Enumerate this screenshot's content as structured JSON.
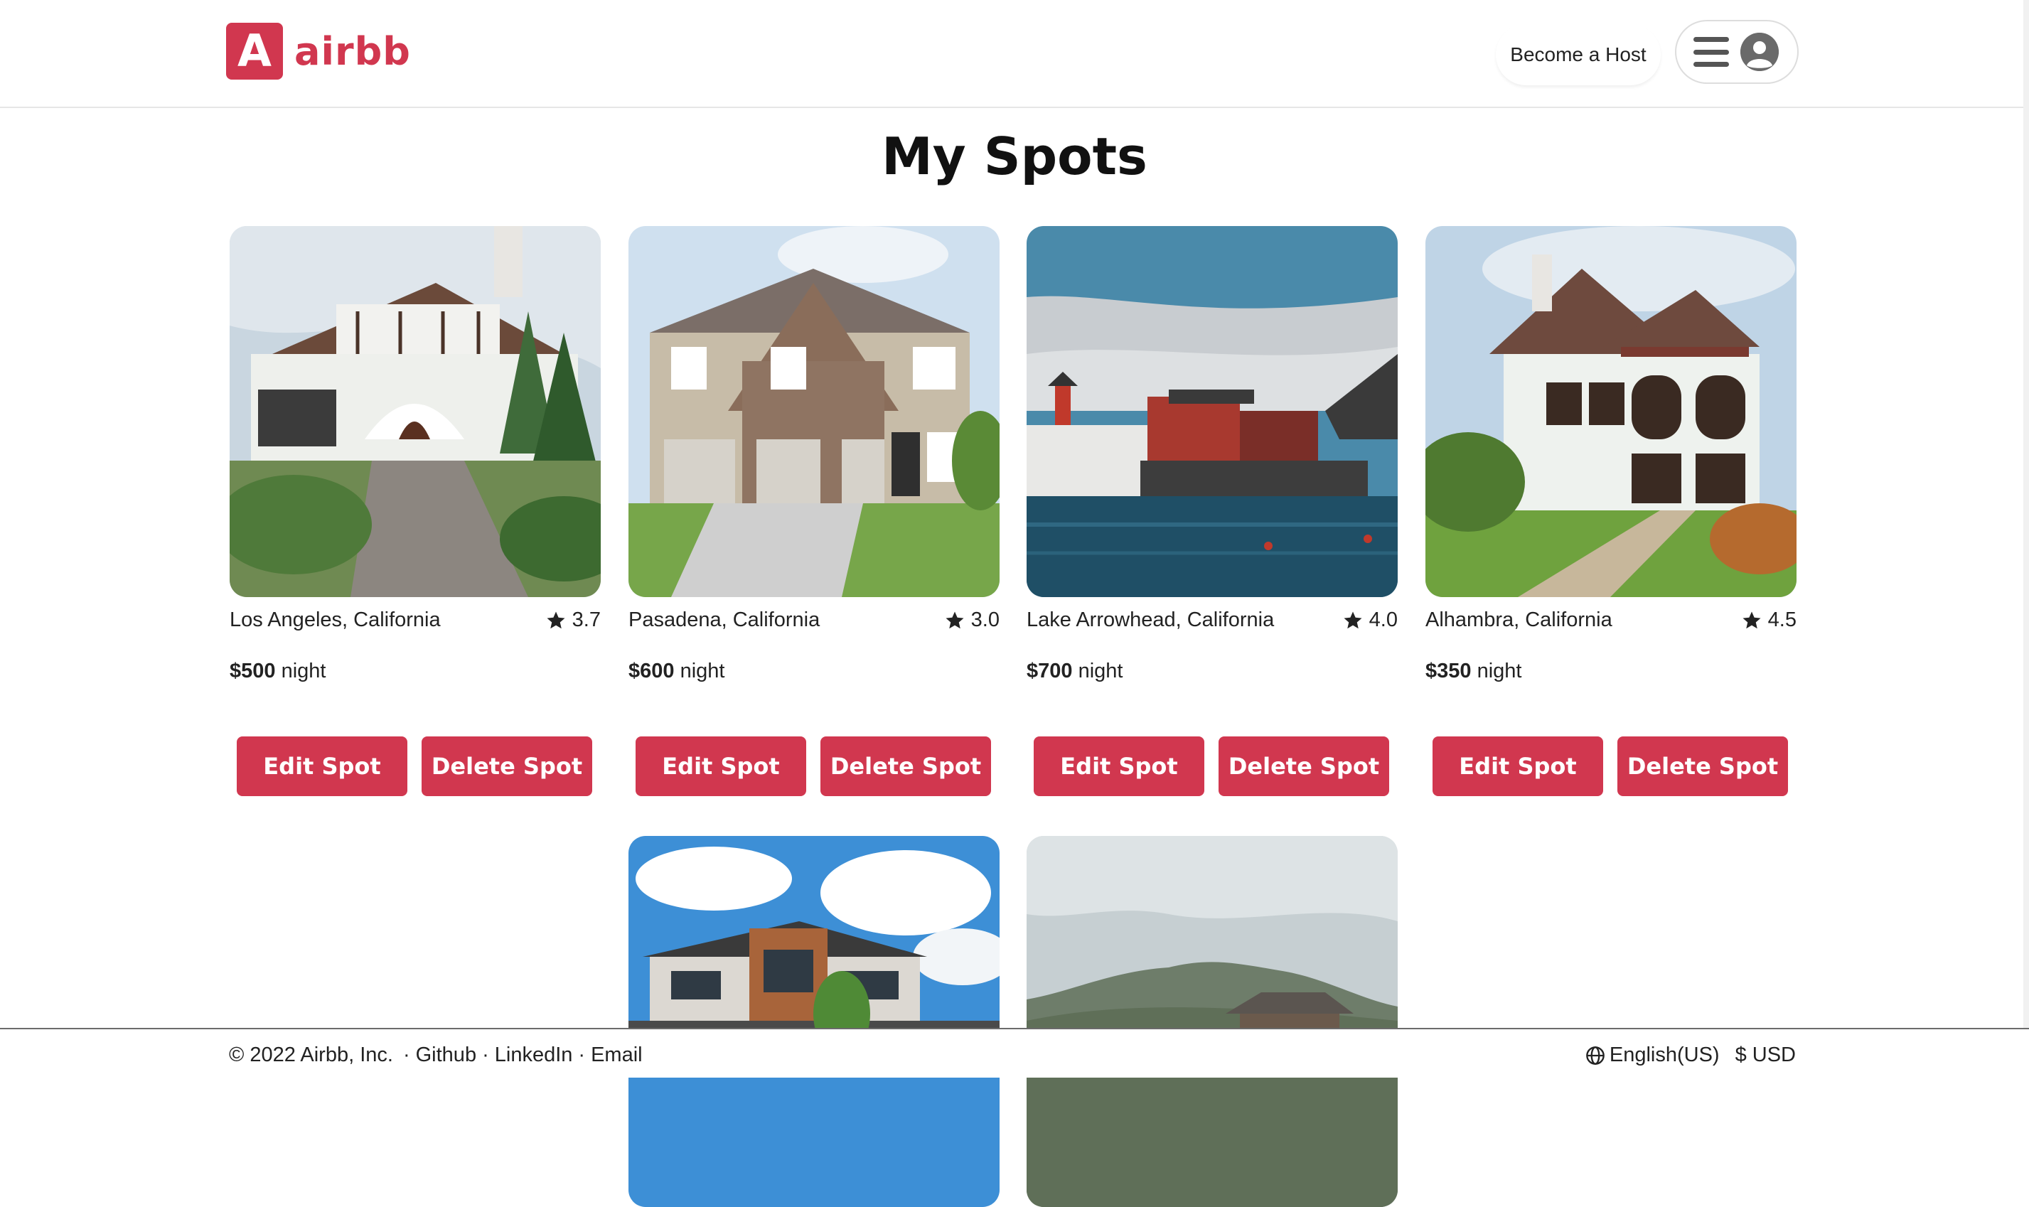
{
  "header": {
    "logo_letter": "A",
    "logo_text": "airbb",
    "become_host": "Become a Host",
    "brand_color": "#d1374f"
  },
  "page": {
    "title": "My Spots"
  },
  "spots": [
    {
      "location": "Los Angeles, California",
      "rating": "3.7",
      "price": "$500",
      "price_unit": "night",
      "edit_label": "Edit Spot",
      "delete_label": "Delete Spot",
      "image": "tudor-style white house with stone path"
    },
    {
      "location": "Pasadena, California",
      "rating": "3.0",
      "price": "$600",
      "price_unit": "night",
      "edit_label": "Edit Spot",
      "delete_label": "Delete Spot",
      "image": "two-story beige house with two-car garage"
    },
    {
      "location": "Lake Arrowhead, California",
      "rating": "4.0",
      "price": "$700",
      "price_unit": "night",
      "edit_label": "Edit Spot",
      "delete_label": "Delete Spot",
      "image": "red waterfront cabins on rocky shore"
    },
    {
      "location": "Alhambra, California",
      "rating": "4.5",
      "price": "$350",
      "price_unit": "night",
      "edit_label": "Edit Spot",
      "delete_label": "Delete Spot",
      "image": "white chalet house with balconies"
    },
    {
      "image": "modern house with wood and stone facade"
    },
    {
      "image": "wooden cabin below mountain"
    }
  ],
  "footer": {
    "copyright": "© 2022 Airbb, Inc.",
    "link_github": "Github",
    "link_linkedin": "LinkedIn",
    "link_email": "Email",
    "separator": "·",
    "language": "English(US)",
    "currency": "$ USD"
  },
  "icons": {
    "logo": "letter-a-logo-icon",
    "menu": "hamburger-menu-icon",
    "user": "user-avatar-icon",
    "rating": "star-icon",
    "language": "globe-icon"
  }
}
